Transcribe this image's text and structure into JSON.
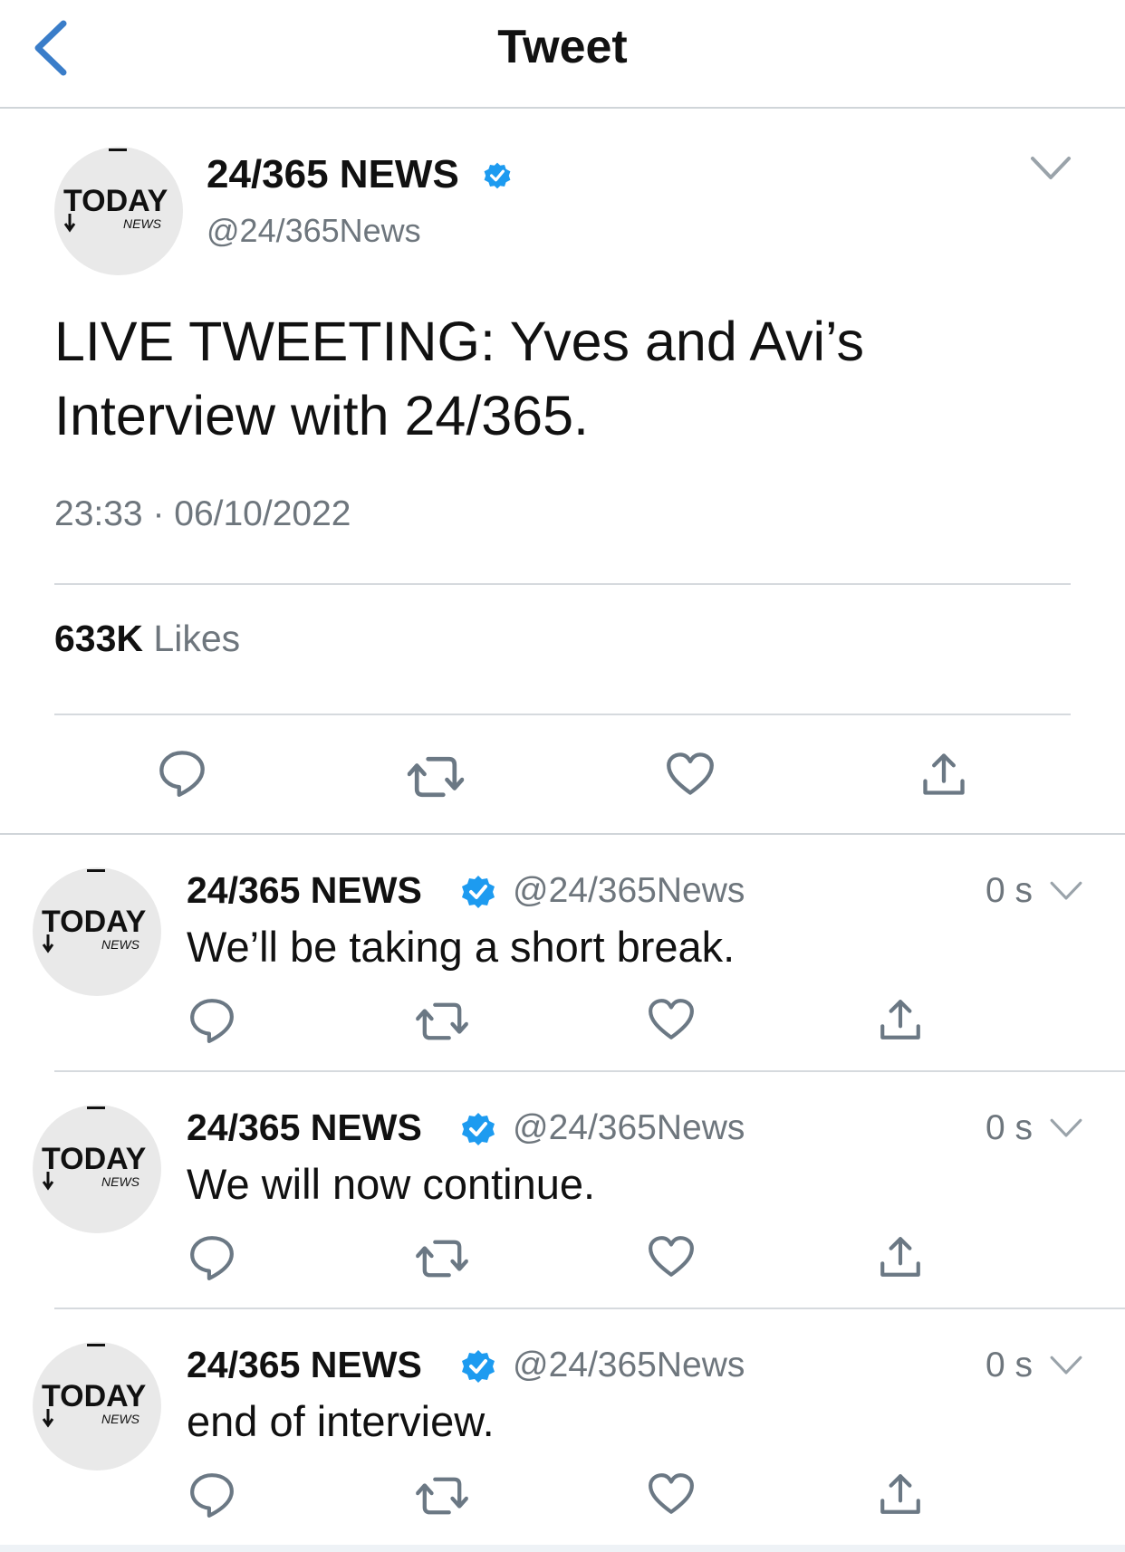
{
  "header": {
    "title": "Tweet"
  },
  "main_tweet": {
    "name": "24/365 NEWS",
    "handle": "@24/365News",
    "text": "LIVE TWEETING: Yves and Avi’s Interview with 24/365.",
    "time": "23:33",
    "date": "06/10/2022",
    "likes_count": "633K",
    "likes_label": "Likes"
  },
  "avatar": {
    "logo_main": "TODAY",
    "logo_sub": "NEWS"
  },
  "replies": [
    {
      "name": "24/365 NEWS",
      "handle": "@24/365News",
      "time": "0 s",
      "text": "We’ll be taking a short break."
    },
    {
      "name": "24/365 NEWS",
      "handle": "@24/365News",
      "time": "0 s",
      "text": "We will now continue."
    },
    {
      "name": "24/365 NEWS",
      "handle": "@24/365News",
      "time": "0 s",
      "text": "end of interview."
    }
  ],
  "icons": {
    "back": "chevron-left-icon",
    "verified": "verified-badge-icon",
    "more": "chevron-down-icon",
    "reply": "comment-icon",
    "retweet": "retweet-icon",
    "like": "heart-icon",
    "share": "share-icon"
  },
  "colors": {
    "accent": "#3a7dc9",
    "verified": "#1d9bf0",
    "muted": "#6e767d",
    "icon": "#657786"
  }
}
